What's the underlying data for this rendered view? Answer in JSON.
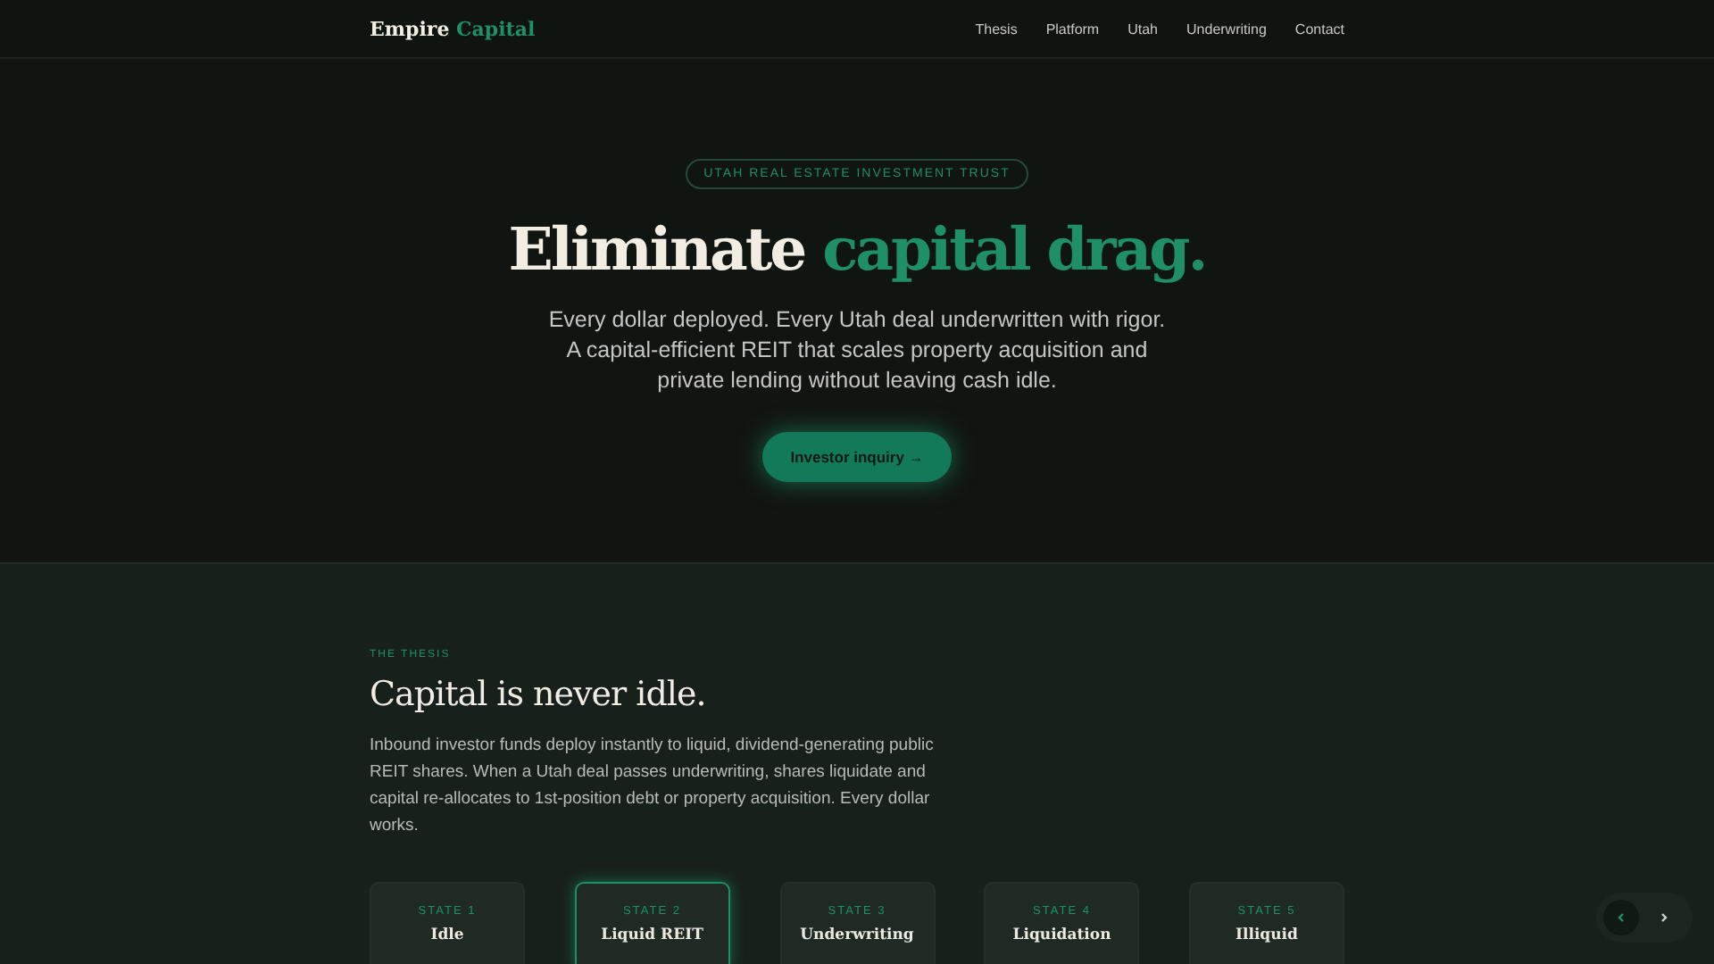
{
  "nav": {
    "brand": {
      "first": "Empire",
      "second": "Capital"
    },
    "links": [
      "Thesis",
      "Platform",
      "Utah",
      "Underwriting",
      "Contact"
    ]
  },
  "hero": {
    "badge": "UTAH REAL ESTATE INVESTMENT TRUST",
    "title_plain": "Eliminate",
    "title_accent": "capital drag.",
    "lede": "Every dollar deployed. Every Utah deal underwritten with rigor. A capital-efficient REIT that scales property acquisition and private lending without leaving cash idle.",
    "cta": "Investor inquiry →"
  },
  "thesis": {
    "eyebrow": "THE THESIS",
    "heading": "Capital is never idle.",
    "body": "Inbound investor funds deploy instantly to liquid, dividend-generating public REIT shares. When a Utah deal passes underwriting, shares liquidate and capital re-allocates to 1st-position debt or property acquisition. Every dollar works.",
    "states": [
      {
        "label": "STATE 1",
        "name": "Idle",
        "selected": false
      },
      {
        "label": "STATE 2",
        "name": "Liquid REIT",
        "selected": true
      },
      {
        "label": "STATE 3",
        "name": "Underwriting",
        "selected": false
      },
      {
        "label": "STATE 4",
        "name": "Liquidation",
        "selected": false
      },
      {
        "label": "STATE 5",
        "name": "Illiquid",
        "selected": false
      }
    ]
  },
  "pager": [
    {
      "selected": true
    },
    {
      "selected": false
    }
  ]
}
